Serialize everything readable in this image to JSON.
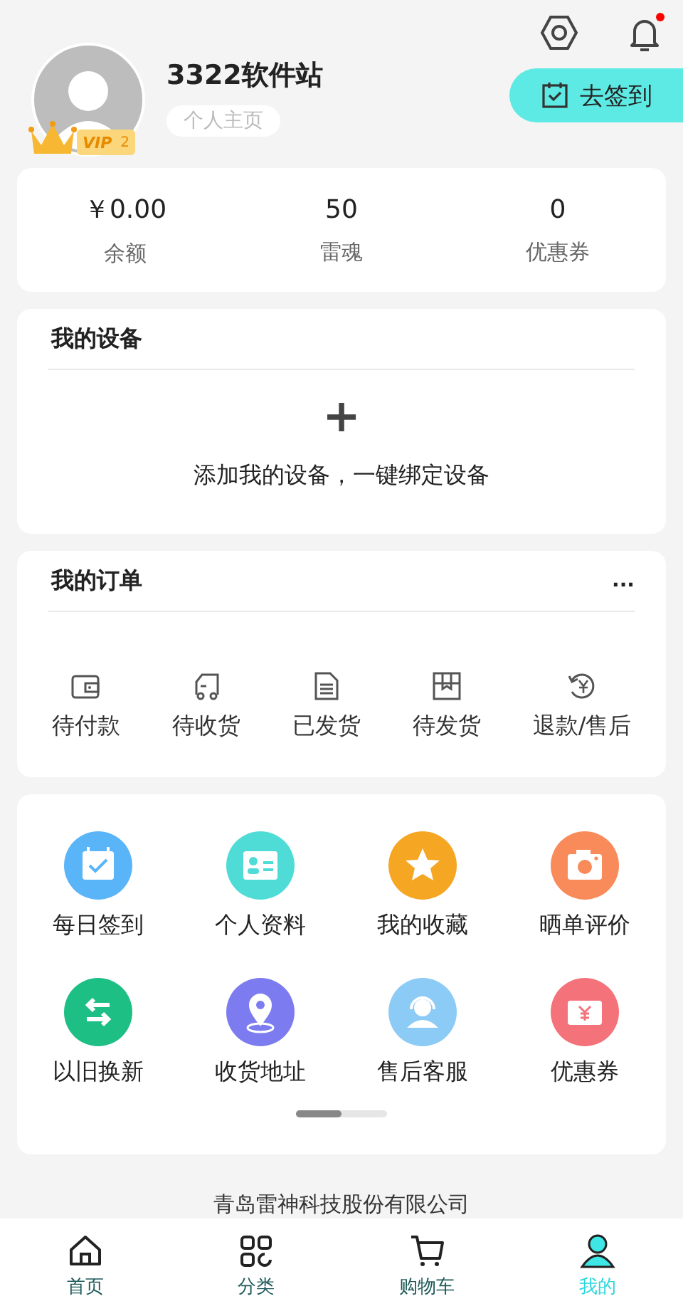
{
  "header": {
    "username": "3322软件站",
    "profile_link": "个人主页",
    "vip_label": "VIP",
    "vip_level": "2",
    "checkin_button": "去签到",
    "bell_unread": true
  },
  "stats": [
    {
      "value": "￥0.00",
      "label": "余额"
    },
    {
      "value": "50",
      "label": "雷魂"
    },
    {
      "value": "0",
      "label": "优惠券"
    }
  ],
  "devices": {
    "title": "我的设备",
    "add_symbol": "+",
    "prompt": "添加我的设备，一键绑定设备"
  },
  "orders": {
    "title": "我的订单",
    "more": "...",
    "items": [
      {
        "kind": "wallet",
        "label": "待付款"
      },
      {
        "kind": "truck",
        "label": "待收货"
      },
      {
        "kind": "document",
        "label": "已发货"
      },
      {
        "kind": "box",
        "label": "待发货"
      },
      {
        "kind": "refund",
        "label": "退款/售后"
      }
    ]
  },
  "services": {
    "items": [
      {
        "kind": "calendar",
        "label": "每日签到",
        "color": "#5ab4f8"
      },
      {
        "kind": "idcard",
        "label": "个人资料",
        "color": "#4fdcd6"
      },
      {
        "kind": "star",
        "label": "我的收藏",
        "color": "#f5a623"
      },
      {
        "kind": "camera",
        "label": "晒单评价",
        "color": "#f98a5a"
      },
      {
        "kind": "swap",
        "label": "以旧换新",
        "color": "#1dbf84"
      },
      {
        "kind": "pin",
        "label": "收货地址",
        "color": "#7c7cf0"
      },
      {
        "kind": "headset",
        "label": "售后客服",
        "color": "#8ccbf5"
      },
      {
        "kind": "ticket",
        "label": "优惠券",
        "color": "#f4727a"
      }
    ],
    "pages": [
      {
        "selected": true
      },
      {
        "selected": false
      }
    ]
  },
  "footer": "青岛雷神科技股份有限公司",
  "nav": [
    {
      "kind": "home",
      "label": "首页",
      "selected": false
    },
    {
      "kind": "grid",
      "label": "分类",
      "selected": false
    },
    {
      "kind": "cart",
      "label": "购物车",
      "selected": false
    },
    {
      "kind": "person",
      "label": "我的",
      "selected": true
    }
  ]
}
